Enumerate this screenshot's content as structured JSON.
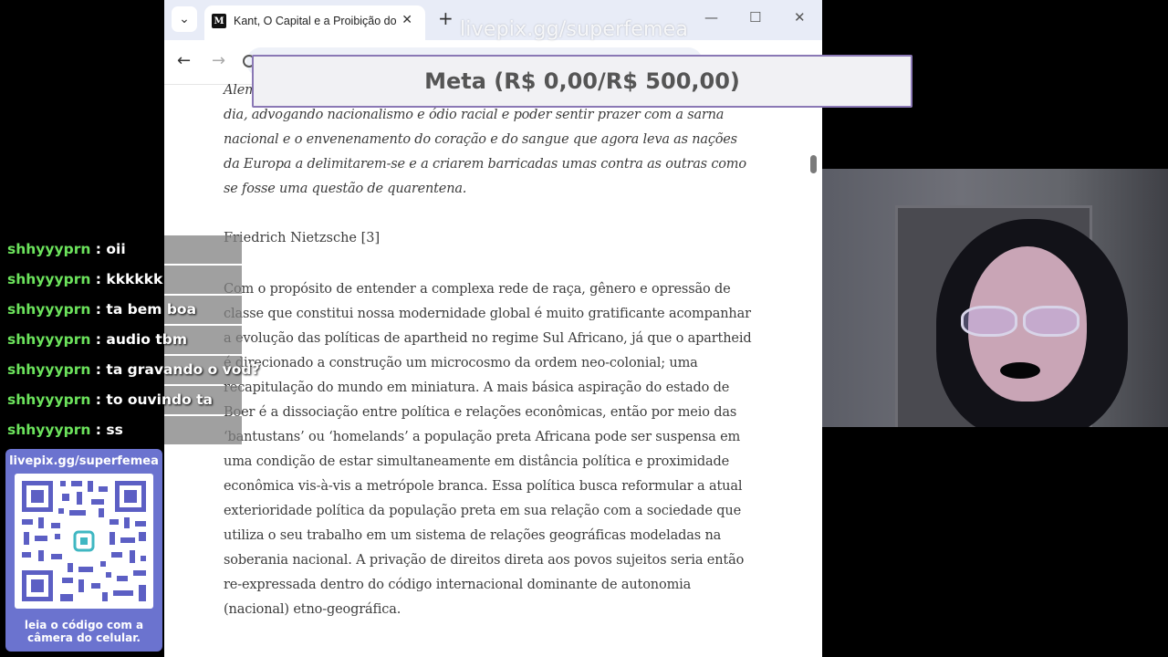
{
  "browser": {
    "tab_title": "Kant, O Capital e a Proibição do",
    "favicon_text": "M",
    "search_tabs_icon": "chevron-down-icon",
    "new_tab_icon": "plus-icon",
    "close_tab_icon": "close-icon"
  },
  "article": {
    "quote_fragment": "Alem",
    "quote": "dia, advogando nacionalismo e ódio racial e poder sentir prazer com a sarna nacional e o envenenamento do coração e do sangue que agora leva as nações da Europa a delimitarem-se e a criarem barricadas umas contra as outras como se fosse uma questão de quarentena.",
    "author": "Friedrich Nietzsche [3]",
    "paragraph": "Com o propósito de entender a complexa rede de raça, gênero e opressão de classe que constitui nossa modernidade global é muito gratificante acompanhar a evolução das políticas de apartheid no regime Sul Africano, já que o apartheid é direcionado a construção um microcosmo da ordem neo-colonial; uma recapitulação do mundo em miniatura. A mais básica aspiração do estado de Boer é a dissociação entre política e relações econômicas, então por meio das ‘bantustans’ ou ‘homelands’ a população preta Africana pode ser suspensa em uma condição de estar simultaneamente em distância política e proximidade econômica vis-à-vis a metrópole branca. Essa política busca reformular a atual exterioridade política da população preta em sua relação com a sociedade que utiliza o seu trabalho em um sistema de relações geográficas modeladas na soberania nacional. A privação de direitos direta aos povos sujeitos seria então re-expressada dentro do código internacional dominante de autonomia (nacional) etno-geográfica."
  },
  "overlay": {
    "watermark": "livepix.gg/superfemea",
    "goal": "Meta (R$ 0,00/R$ 500,00)"
  },
  "chat": {
    "messages": [
      {
        "user": "shhyyyprn",
        "text": "oii"
      },
      {
        "user": "shhyyyprn",
        "text": "kkkkkk"
      },
      {
        "user": "shhyyyprn",
        "text": "ta bem boa"
      },
      {
        "user": "shhyyyprn",
        "text": "audio tbm"
      },
      {
        "user": "shhyyyprn",
        "text": "ta gravando o vod?"
      },
      {
        "user": "shhyyyprn",
        "text": "to ouvindo ta"
      },
      {
        "user": "shhyyyprn",
        "text": "ss"
      }
    ],
    "separator": ":",
    "user_color": "#6ce35c"
  },
  "qr": {
    "url": "livepix.gg/superfemea",
    "caption_line1": "leia o código com a",
    "caption_line2": "câmera do celular.",
    "panel_color": "#6b73cf",
    "code_color": "#5c5fc4"
  }
}
